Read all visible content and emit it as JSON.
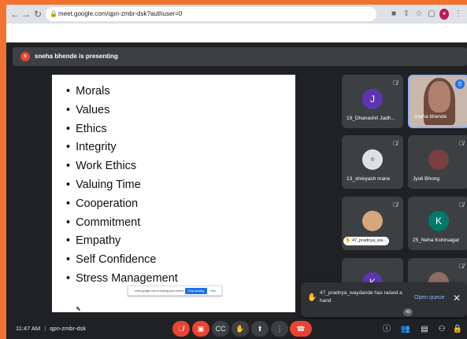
{
  "browser": {
    "url": "meet.google.com/qpn-zmbr-dsk?authuser=0",
    "icons": [
      "back-icon",
      "forward-icon",
      "reload-icon",
      "lock-icon",
      "camera-icon",
      "share-icon",
      "star-icon",
      "sidebar-icon",
      "profile-icon",
      "menu-icon"
    ]
  },
  "presenter_banner": {
    "initial": "s",
    "text": "sneha bhende is presenting"
  },
  "slide": {
    "bullets": [
      "Morals",
      "Values",
      "Ethics",
      "Integrity",
      "Work Ethics",
      "Valuing Time",
      "Cooperation",
      "Commitment",
      "Empathy",
      "Self Confidence",
      "Stress Management"
    ],
    "share_notice": {
      "message": "meet.google.com is sharing your screen.",
      "stop_label": "Stop sharing",
      "hide_label": "Hide"
    }
  },
  "participants": [
    {
      "name": "19_Dhanashri Jadh...",
      "initial": "J",
      "avatar_color": "#5e35b1"
    },
    {
      "name": "sneha bhende",
      "initial": "",
      "avatar_color": "#c9b7ad"
    },
    {
      "name": "13_shreyash mane",
      "initial": "",
      "avatar_color": "#e0e0e0"
    },
    {
      "name": "Jyoti Bhong",
      "initial": "",
      "avatar_color": "#7b3f3f"
    },
    {
      "name": "47_pradnya_wa...",
      "initial": "",
      "avatar_color": "#d7a77a"
    },
    {
      "name": "25_Neha Kshirsagar",
      "initial": "K",
      "avatar_color": "#00796b"
    },
    {
      "name": "",
      "initial": "K",
      "avatar_color": "#5e35b1"
    },
    {
      "name": "",
      "initial": "",
      "avatar_color": "#8d6e63"
    }
  ],
  "toast": {
    "message": "47_pradnya_waydande has raised a hand",
    "action": "Open queue",
    "close": "✕"
  },
  "bottom_bar": {
    "time": "11:47 AM",
    "separator": "|",
    "meeting_code": "qpn-zmbr-dsk",
    "participant_count": "49",
    "controls": [
      "mic-off-icon",
      "camera-off-icon",
      "captions-icon",
      "raise-hand-icon",
      "present-icon",
      "more-options-icon",
      "end-call-icon"
    ],
    "right_icons": [
      "info-icon",
      "people-icon",
      "chat-icon",
      "activities-icon",
      "host-controls-icon"
    ]
  },
  "colors": {
    "accent": "#1a73e8",
    "danger": "#ea4335",
    "background": "#202124",
    "tile": "#3c4043",
    "outer_border": "#f07430"
  }
}
